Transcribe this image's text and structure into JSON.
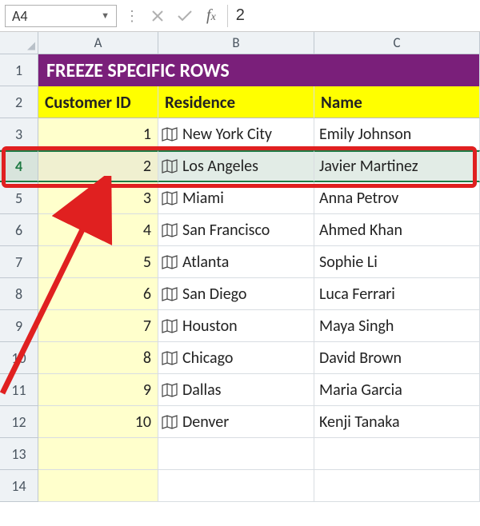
{
  "name_box": "A4",
  "formula_value": "2",
  "columns": [
    "A",
    "B",
    "C"
  ],
  "title": "FREEZE SPECIFIC ROWS",
  "headers": {
    "id": "Customer ID",
    "residence": "Residence",
    "name": "Name"
  },
  "rows": [
    {
      "n": 3,
      "id": "1",
      "residence": "New York City",
      "name": "Emily Johnson"
    },
    {
      "n": 4,
      "id": "2",
      "residence": "Los Angeles",
      "name": "Javier Martinez"
    },
    {
      "n": 5,
      "id": "3",
      "residence": "Miami",
      "name": "Anna Petrov"
    },
    {
      "n": 6,
      "id": "4",
      "residence": "San Francisco",
      "name": "Ahmed Khan"
    },
    {
      "n": 7,
      "id": "5",
      "residence": "Atlanta",
      "name": "Sophie Li"
    },
    {
      "n": 8,
      "id": "6",
      "residence": "San Diego",
      "name": "Luca Ferrari"
    },
    {
      "n": 9,
      "id": "7",
      "residence": "Houston",
      "name": "Maya Singh"
    },
    {
      "n": 10,
      "id": "8",
      "residence": "Chicago",
      "name": "David Brown"
    },
    {
      "n": 11,
      "id": "9",
      "residence": "Dallas",
      "name": "Maria Garcia"
    },
    {
      "n": 12,
      "id": "10",
      "residence": "Denver",
      "name": "Kenji Tanaka"
    }
  ],
  "empty_rows": [
    13,
    14
  ],
  "selected_row": 4,
  "annotation": {
    "highlight_row": 4
  }
}
